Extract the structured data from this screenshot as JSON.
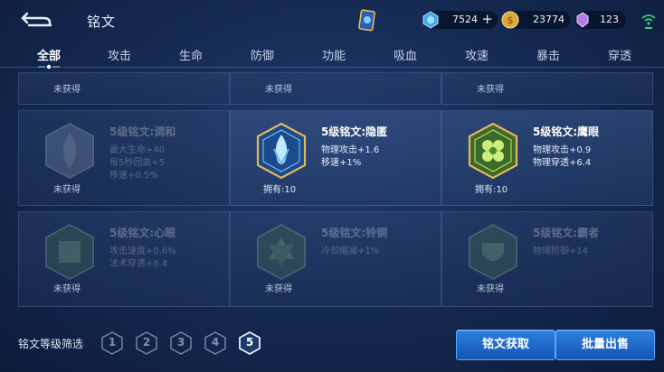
{
  "header": {
    "title": "铭文",
    "resources": {
      "diamond": "7524",
      "gold": "23774",
      "crystal": "123"
    }
  },
  "tabs": [
    "全部",
    "攻击",
    "生命",
    "防御",
    "功能",
    "吸血",
    "攻速",
    "暴击",
    "穿透"
  ],
  "status_unobtained": "未获得",
  "runes": [
    {
      "name": "5级铭文:调和",
      "attrs": [
        "最大生命+40",
        "每5秒回血+5",
        "移速+0.5%"
      ],
      "owned": false
    },
    {
      "name": "5级铭文:隐匿",
      "attrs": [
        "物理攻击+1.6",
        "移速+1%"
      ],
      "owned": true,
      "owned_text": "拥有:10"
    },
    {
      "name": "5级铭文:鹰眼",
      "attrs": [
        "物理攻击+0.9",
        "物理穿透+6.4"
      ],
      "owned": true,
      "owned_text": "拥有:10"
    },
    {
      "name": "5级铭文:心眼",
      "attrs": [
        "攻击速度+0.6%",
        "法术穿透+6.4"
      ],
      "owned": false
    },
    {
      "name": "5级铭文:铃铜",
      "attrs": [
        "冷却缩减+1%"
      ],
      "owned": false
    },
    {
      "name": "5级铭文:霸者",
      "attrs": [
        "物理防御+14"
      ],
      "owned": false
    }
  ],
  "filter": {
    "label": "铭文等级筛选",
    "levels": [
      "1",
      "2",
      "3",
      "4",
      "5"
    ],
    "selected": "5"
  },
  "buttons": {
    "obtain": "铭文获取",
    "sell": "批量出售"
  },
  "colors": {
    "accent": "#2d7ee0",
    "owned_text": "#ffffff",
    "selected_level": "#ffffff"
  }
}
